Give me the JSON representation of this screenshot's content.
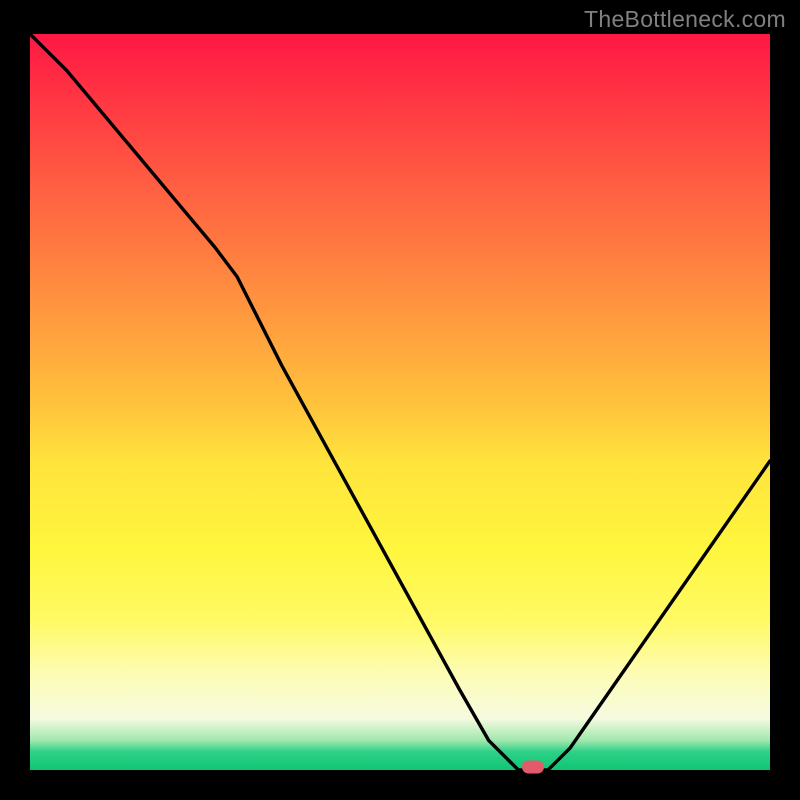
{
  "watermark": "TheBottleneck.com",
  "chart_data": {
    "type": "line",
    "title": "",
    "xlabel": "",
    "ylabel": "",
    "xlim": [
      0,
      1
    ],
    "ylim": [
      0,
      1
    ],
    "x": [
      0.0,
      0.05,
      0.1,
      0.15,
      0.2,
      0.25,
      0.28,
      0.34,
      0.4,
      0.46,
      0.52,
      0.58,
      0.62,
      0.66,
      0.7,
      0.73,
      1.0
    ],
    "y_value": [
      1.0,
      0.95,
      0.89,
      0.83,
      0.77,
      0.71,
      0.67,
      0.55,
      0.44,
      0.33,
      0.22,
      0.11,
      0.04,
      0.0,
      0.0,
      0.03,
      0.42
    ],
    "marker": {
      "x": 0.68,
      "y_value": 0.0
    },
    "note": "x is normalized horizontal position across plot area; y_value is normalized height (0 at bottom/minimum, 1 at top). Curve is a V-shape over a vertical red→yellow→green gradient; minimum lies on the green band."
  },
  "colors": {
    "curve": "#000000",
    "marker": "#e35b6a",
    "background": "#000000"
  }
}
